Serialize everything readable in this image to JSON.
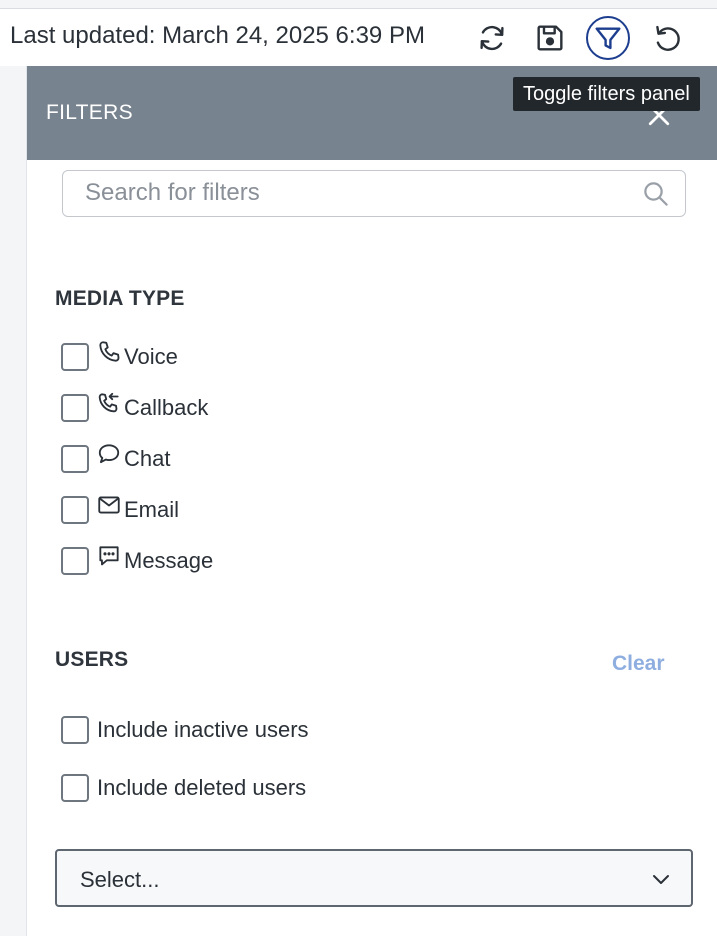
{
  "toolbar": {
    "last_updated": "Last updated: March 24, 2025 6:39 PM",
    "icons": [
      "refresh-icon",
      "save-icon",
      "filter-icon",
      "undo-icon"
    ],
    "tooltip": "Toggle filters panel"
  },
  "panel": {
    "title": "FILTERS",
    "search": {
      "placeholder": "Search for filters",
      "value": ""
    },
    "media_type": {
      "title": "MEDIA TYPE",
      "items": [
        {
          "label": "Voice",
          "icon": "phone-icon",
          "checked": false
        },
        {
          "label": "Callback",
          "icon": "callback-icon",
          "checked": false
        },
        {
          "label": "Chat",
          "icon": "chat-bubble-icon",
          "checked": false
        },
        {
          "label": "Email",
          "icon": "envelope-icon",
          "checked": false
        },
        {
          "label": "Message",
          "icon": "message-icon",
          "checked": false
        }
      ]
    },
    "users": {
      "title": "USERS",
      "clear_label": "Clear",
      "options": [
        {
          "label": "Include inactive users",
          "checked": false
        },
        {
          "label": "Include deleted users",
          "checked": false
        }
      ],
      "select_placeholder": "Select..."
    }
  },
  "colors": {
    "header_bg": "#77838f",
    "active_icon_ring": "#1d3d8f",
    "clear_link": "#8faee0",
    "tooltip_bg": "#22272c"
  }
}
